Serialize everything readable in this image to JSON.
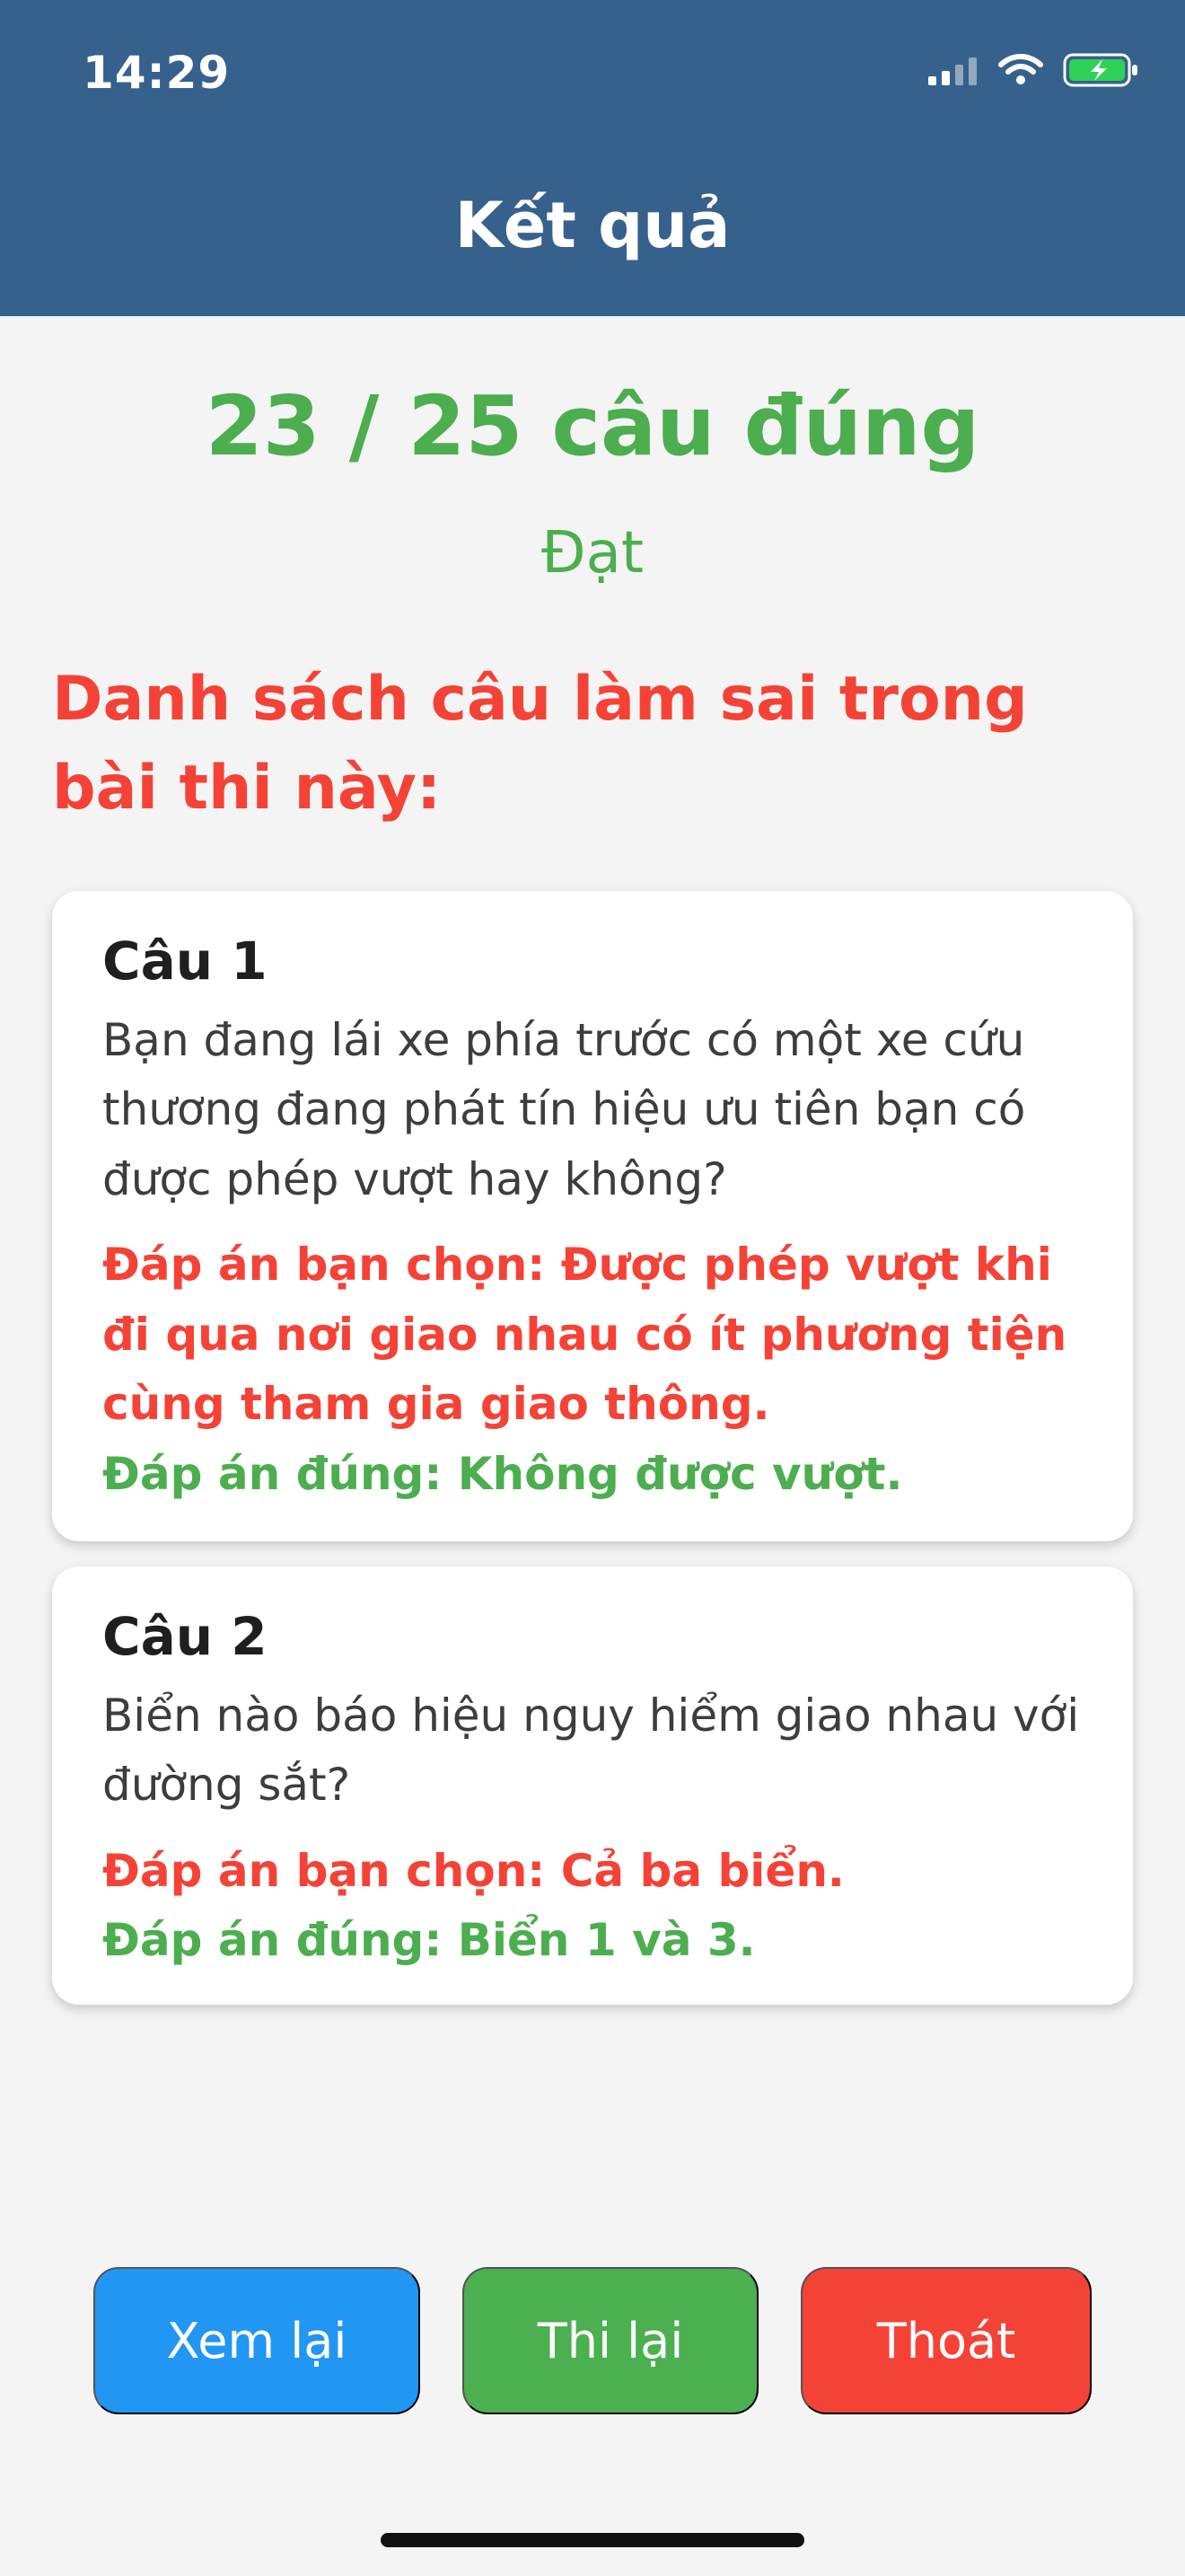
{
  "status_bar": {
    "time": "14:29",
    "icons": [
      "signal-icon",
      "wifi-icon",
      "battery-charging-icon"
    ]
  },
  "header": {
    "title": "Kết quả"
  },
  "result": {
    "score_text": "23 / 25 câu đúng",
    "status": "Đạt",
    "wrong_list_heading": "Danh sách câu làm sai trong bài thi này:"
  },
  "wrong_questions": [
    {
      "title": "Câu 1",
      "question": "Bạn đang lái xe phía trước có một xe cứu thương đang phát tín hiệu ưu tiên bạn có được phép vượt hay không?",
      "chosen_answer": "Đáp án bạn chọn: Được phép vượt khi đi qua nơi giao nhau có ít phương tiện cùng tham gia giao thông.",
      "correct_answer": "Đáp án đúng: Không được vượt."
    },
    {
      "title": "Câu 2",
      "question": "Biển nào báo hiệu nguy hiểm giao nhau với đường sắt?",
      "chosen_answer": "Đáp án bạn chọn: Cả ba biển.",
      "correct_answer": "Đáp án đúng: Biển 1 và 3."
    }
  ],
  "actions": {
    "review_label": "Xem lại",
    "retake_label": "Thi lại",
    "exit_label": "Thoát"
  },
  "colors": {
    "header_bg": "#37618d",
    "success": "#4cae4f",
    "error": "#f44336",
    "review_button": "#2196f3",
    "retake_button": "#4caf50",
    "exit_button": "#f44336",
    "page_bg": "#f4f4f4"
  }
}
